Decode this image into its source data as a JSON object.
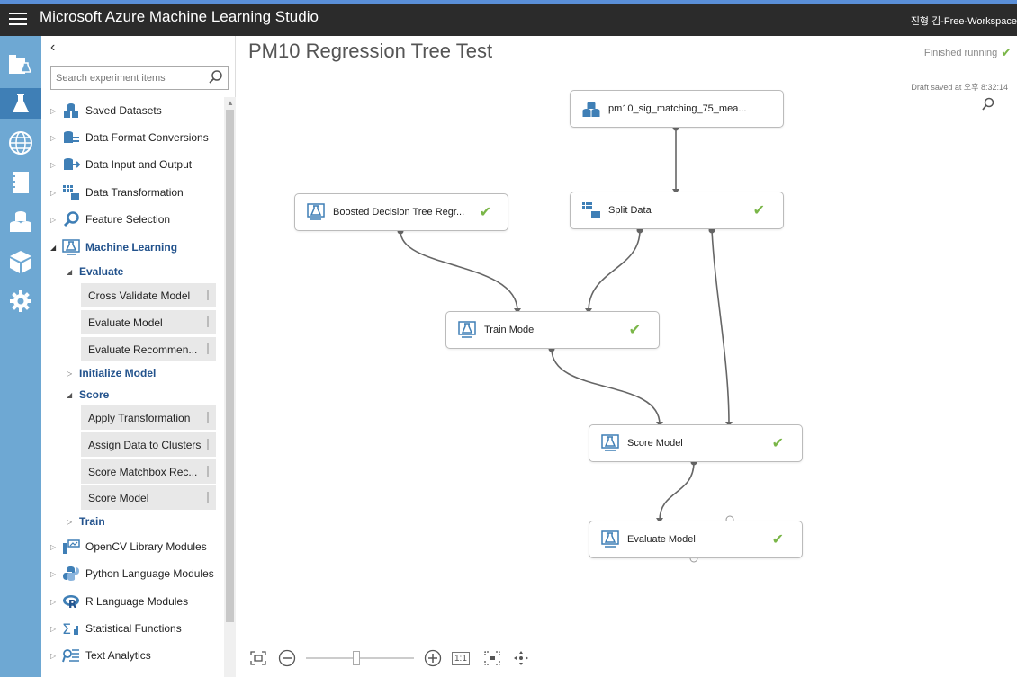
{
  "header": {
    "title": "Microsoft Azure Machine Learning Studio",
    "workspace": "진형 김-Free-Workspace"
  },
  "palette": {
    "collapse": "‹",
    "search_placeholder": "Search experiment items",
    "categories": [
      {
        "label": "Saved Datasets"
      },
      {
        "label": "Data Format Conversions"
      },
      {
        "label": "Data Input and Output"
      },
      {
        "label": "Data Transformation"
      },
      {
        "label": "Feature Selection"
      },
      {
        "label": "Machine Learning"
      }
    ],
    "ml_children": {
      "evaluate": "Evaluate",
      "evaluate_modules": [
        "Cross Validate Model",
        "Evaluate Model",
        "Evaluate Recommen..."
      ],
      "initialize": "Initialize Model",
      "score": "Score",
      "score_modules": [
        "Apply Transformation",
        "Assign Data to Clusters",
        "Score Matchbox Rec...",
        "Score Model"
      ],
      "train": "Train"
    },
    "bottom_categories": [
      {
        "label": "OpenCV Library Modules"
      },
      {
        "label": "Python Language Modules"
      },
      {
        "label": "R Language Modules"
      },
      {
        "label": "Statistical Functions"
      },
      {
        "label": "Text Analytics"
      }
    ]
  },
  "canvas": {
    "title": "PM10 Regression Tree Test",
    "status": "Finished running",
    "draft": "Draft saved at 오후 8:32:14",
    "nodes": {
      "dataset": "pm10_sig_matching_75_mea...",
      "boosted": "Boosted Decision Tree Regr...",
      "split": "Split Data",
      "train": "Train Model",
      "score": "Score Model",
      "evaluate": "Evaluate Model"
    },
    "zoom": {
      "ratio_label": "1:1"
    }
  },
  "colors": {
    "accent": "#3f7fb6",
    "check": "#7ab648",
    "iconbar": "#6ea8d3",
    "topbar": "#2b2b2b"
  }
}
